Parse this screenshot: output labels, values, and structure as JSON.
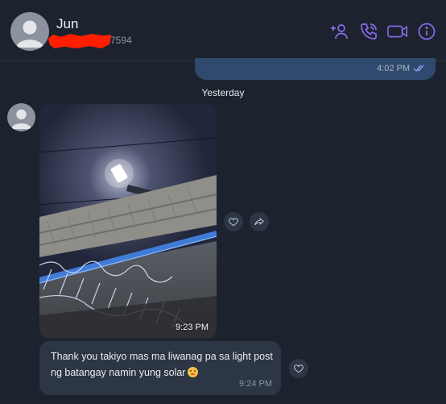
{
  "header": {
    "contact_name": "Jun",
    "phone_visible_suffix": "7594",
    "icons": [
      "add-contact-icon",
      "phone-call-icon",
      "video-call-icon",
      "info-icon"
    ],
    "accent_color": "#8a6cf0"
  },
  "previous_outgoing": {
    "time": "4:02 PM",
    "status_icon": "double-check-icon"
  },
  "day_separator": "Yesterday",
  "messages": [
    {
      "type": "photo",
      "description_icon": "photo-message",
      "time": "9:23 PM",
      "actions": [
        "heart-icon",
        "forward-icon"
      ]
    },
    {
      "type": "text",
      "text": "Thank you takiyo mas ma liwanag pa sa light post ng batangay namin yung solar",
      "emoji": "pleading-face-emoji",
      "time": "9:24 PM",
      "actions": [
        "heart-icon"
      ]
    }
  ],
  "colors": {
    "background": "#1c232e",
    "incoming_bubble": "#2c3644",
    "outgoing_bubble": "#2f4a6e"
  }
}
